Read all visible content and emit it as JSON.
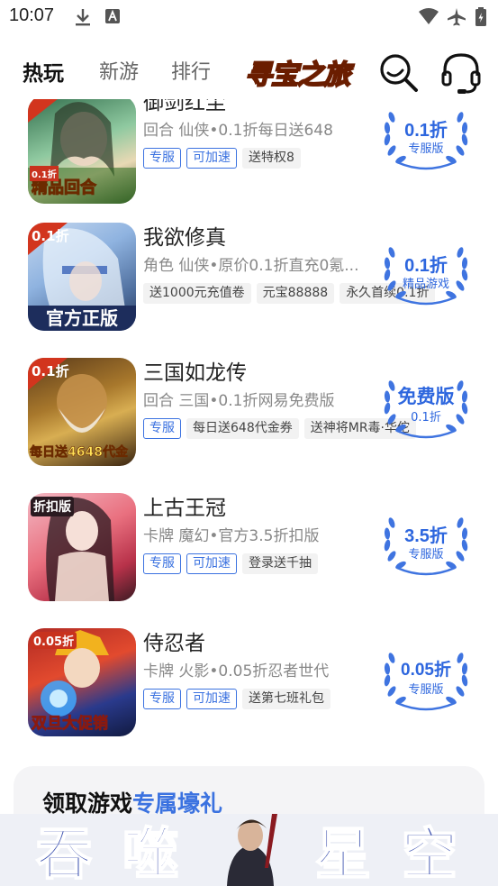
{
  "status": {
    "time": "10:07"
  },
  "nav": {
    "tabs": [
      {
        "label": "热玩",
        "active": true
      },
      {
        "label": "新游",
        "active": false
      },
      {
        "label": "排行",
        "active": false
      }
    ],
    "promo_label": "寻宝之旅",
    "search_icon": "search-icon",
    "service_icon": "headset-icon"
  },
  "games": [
    {
      "title": "御剑红尘",
      "subtitle": "回合 仙侠•0.1折每日送648",
      "tags": [
        {
          "text": "专服",
          "style": "blue"
        },
        {
          "text": "可加速",
          "style": "blue"
        },
        {
          "text": "送特权8",
          "style": "gray"
        }
      ],
      "badge_main": "0.1折",
      "badge_sub": "专服版",
      "thumb_text": "精品回合",
      "thumb_corner": "0.1折"
    },
    {
      "title": "我欲修真",
      "subtitle": "角色 仙侠•原价0.1折直充0氪...",
      "tags": [
        {
          "text": "送1000元充值卷",
          "style": "gray"
        },
        {
          "text": "元宝88888",
          "style": "gray"
        },
        {
          "text": "永久首续0.1折",
          "style": "gray"
        }
      ],
      "badge_main": "0.1折",
      "badge_sub": "精品游戏",
      "thumb_text": "官方正版",
      "thumb_corner": "0.1折"
    },
    {
      "title": "三国如龙传",
      "subtitle": "回合 三国•0.1折网易免费版",
      "tags": [
        {
          "text": "专服",
          "style": "blue"
        },
        {
          "text": "每日送648代金券",
          "style": "gray"
        },
        {
          "text": "送神将MR毒·华佗",
          "style": "gray"
        }
      ],
      "badge_main": "免费版",
      "badge_sub": "0.1折",
      "thumb_text": "每日送4648代金",
      "thumb_corner": "0.1折"
    },
    {
      "title": "上古王冠",
      "subtitle": "卡牌 魔幻•官方3.5折扣版",
      "tags": [
        {
          "text": "专服",
          "style": "blue"
        },
        {
          "text": "可加速",
          "style": "blue"
        },
        {
          "text": "登录送千抽",
          "style": "gray"
        }
      ],
      "badge_main": "3.5折",
      "badge_sub": "专服版",
      "thumb_text": "",
      "thumb_corner": "折扣版"
    },
    {
      "title": "侍忍者",
      "subtitle": "卡牌 火影•0.05折忍者世代",
      "tags": [
        {
          "text": "专服",
          "style": "blue"
        },
        {
          "text": "可加速",
          "style": "blue"
        },
        {
          "text": "送第七班礼包",
          "style": "gray"
        }
      ],
      "badge_main": "0.05折",
      "badge_sub": "专服版",
      "thumb_text": "双旦大促销",
      "thumb_corner": "0.05折"
    }
  ],
  "gift": {
    "title_plain": "领取游戏",
    "title_highlight": "专属壕礼"
  },
  "banner": {
    "chars": [
      "吞",
      "噬",
      "星",
      "空"
    ]
  },
  "colors": {
    "accent": "#3b72e0",
    "badge": "#2d66de"
  }
}
